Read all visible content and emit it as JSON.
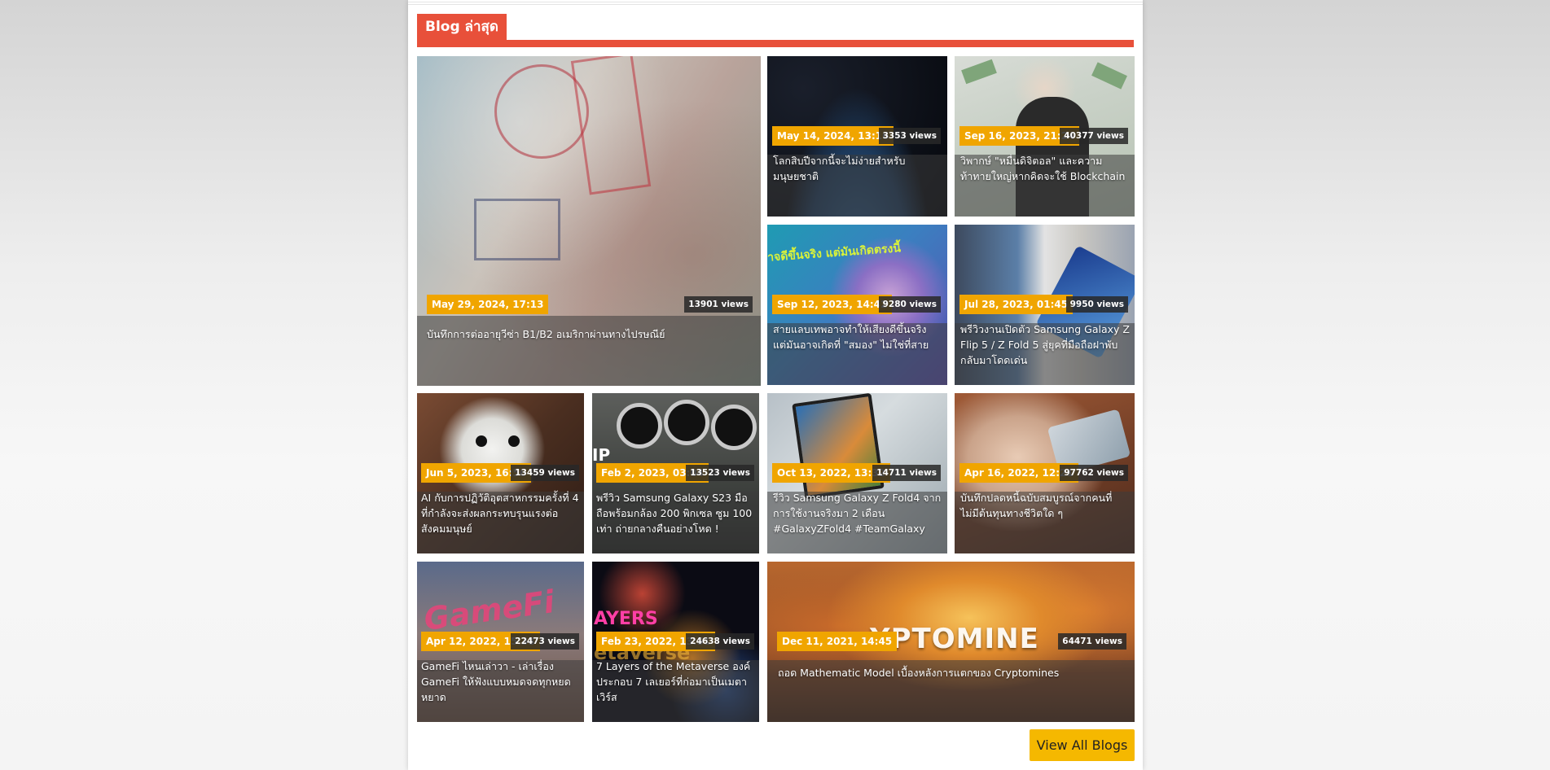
{
  "section": {
    "title": "Blog ล่าสุด"
  },
  "view_all_label": "View All Blogs",
  "accent_colors": {
    "section": "#e8503a",
    "date_badge": "#f0a500",
    "button": "#f5b800"
  },
  "cards": [
    {
      "date": "May 29, 2024, 17:13",
      "views": "13901 views",
      "title": "บันทึกการต่ออายุวีซ่า B1/B2 อเมริกาผ่านทางไปรษณีย์"
    },
    {
      "date": "May 14, 2024, 13:16",
      "views": "3353 views",
      "title": "โลกสิบปีจากนี้จะไม่ง่ายสำหรับมนุษยชาติ"
    },
    {
      "date": "Sep 16, 2023, 21:24",
      "views": "40377 views",
      "title": "วิพากษ์ \"หมื่นดิจิตอล\" และความท้าทายใหญ่หากคิดจะใช้ Blockchain"
    },
    {
      "date": "Sep 12, 2023, 14:42",
      "views": "9280 views",
      "title": "สายแลบเทพอาจทำให้เสียงดีขึ้นจริง แต่มันอาจเกิดที่ \"สมอง\" ไม่ใช่ที่สาย",
      "image_text": "าจดีขึ้นจริง แต่มันเกิดตรงนี้"
    },
    {
      "date": "Jul 28, 2023, 01:45",
      "views": "9950 views",
      "title": "พรีวิวงานเปิดตัว Samsung Galaxy Z Flip 5 / Z Fold 5 สู่ยุคที่มือถือฝาพับกลับมาโดดเด่น"
    },
    {
      "date": "Jun 5, 2023, 16:56",
      "views": "13459 views",
      "title": "AI กับการปฏิวัติอุตสาหกรรมครั้งที่ 4 ที่กำลังจะส่งผลกระทบรุนแรงต่อสังคมมนุษย์"
    },
    {
      "date": "Feb 2, 2023, 03:04",
      "views": "13523 views",
      "title": "พรีวิว Samsung Galaxy S23 มือถือพร้อมกล้อง 200 พิกเซล ซูม 100 เท่า ถ่ายกลางคืนอย่างโหด !",
      "image_text": "IP"
    },
    {
      "date": "Oct 13, 2022, 13:32",
      "views": "14711 views",
      "title": "รีวิว Samsung Galaxy Z Fold4 จากการใช้งานจริงมา 2 เดือน #GalaxyZFold4 #TeamGalaxy"
    },
    {
      "date": "Apr 16, 2022, 12:21",
      "views": "97762 views",
      "title": "บันทึกปลดหนี้ฉบับสมบูรณ์จากคนที่ไม่มีต้นทุนทางชีวิตใด ๆ"
    },
    {
      "date": "Apr 12, 2022, 15:38",
      "views": "22473 views",
      "title": "GameFi ไหนเล่าวา - เล่าเรื่อง GameFi ให้ฟังแบบหมดจดทุกหยดหยาด",
      "image_text": "GameFi"
    },
    {
      "date": "Feb 23, 2022, 13:51",
      "views": "24638 views",
      "title": "7 Layers of the Metaverse องค์ประกอบ 7 เลเยอร์ที่ก่อมาเป็นเมตาเวิร์ส",
      "image_text": "AYERS",
      "image_text2": "etaverse"
    },
    {
      "date": "Dec 11, 2021, 14:45",
      "views": "64471 views",
      "title": "ถอด Mathematic Model เบื้องหลังการแตกของ Cryptomines",
      "image_text": "YPTOMINE"
    }
  ]
}
